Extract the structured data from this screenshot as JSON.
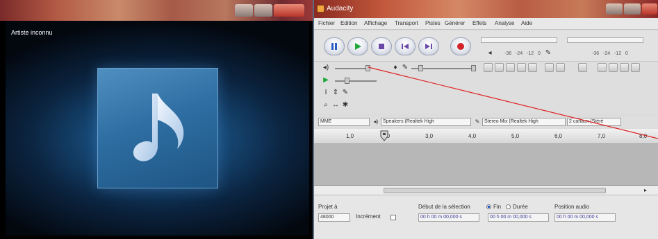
{
  "player": {
    "artist_label": "Artiste inconnu",
    "album_art_icon": "music-note-icon"
  },
  "audacity": {
    "title": "Audacity",
    "menu": [
      "Fichier",
      "Edition",
      "Affichage",
      "Transport",
      "Pistes",
      "Générer",
      "Effets",
      "Analyse",
      "Aide"
    ],
    "transport_buttons": [
      "pause-icon",
      "play-icon",
      "loop-icon",
      "skip-start-icon",
      "skip-end-icon",
      "record-icon"
    ],
    "meter_scale_labels": [
      "-36",
      "-24",
      "-12",
      "0"
    ],
    "device_bar": {
      "host": "MME",
      "output_device": "Speakers (Realtek High",
      "input_device": "Stereo Mix (Realtek High",
      "channels": "2 canaux (Stéré"
    },
    "ruler_labels": [
      "1,0",
      "2,0",
      "3,0",
      "4,0",
      "5,0",
      "6,0",
      "7,0",
      "8,0"
    ],
    "selection_bar": {
      "project_rate_label": "Projet à",
      "project_rate_value": "48000",
      "snap_label": "Incrément",
      "selection_start_label": "Début de la sélection",
      "end_label": "Fin",
      "length_label": "Durée",
      "audio_position_label": "Position audio",
      "time_value": "00 h 00 m 00,000 s"
    }
  }
}
